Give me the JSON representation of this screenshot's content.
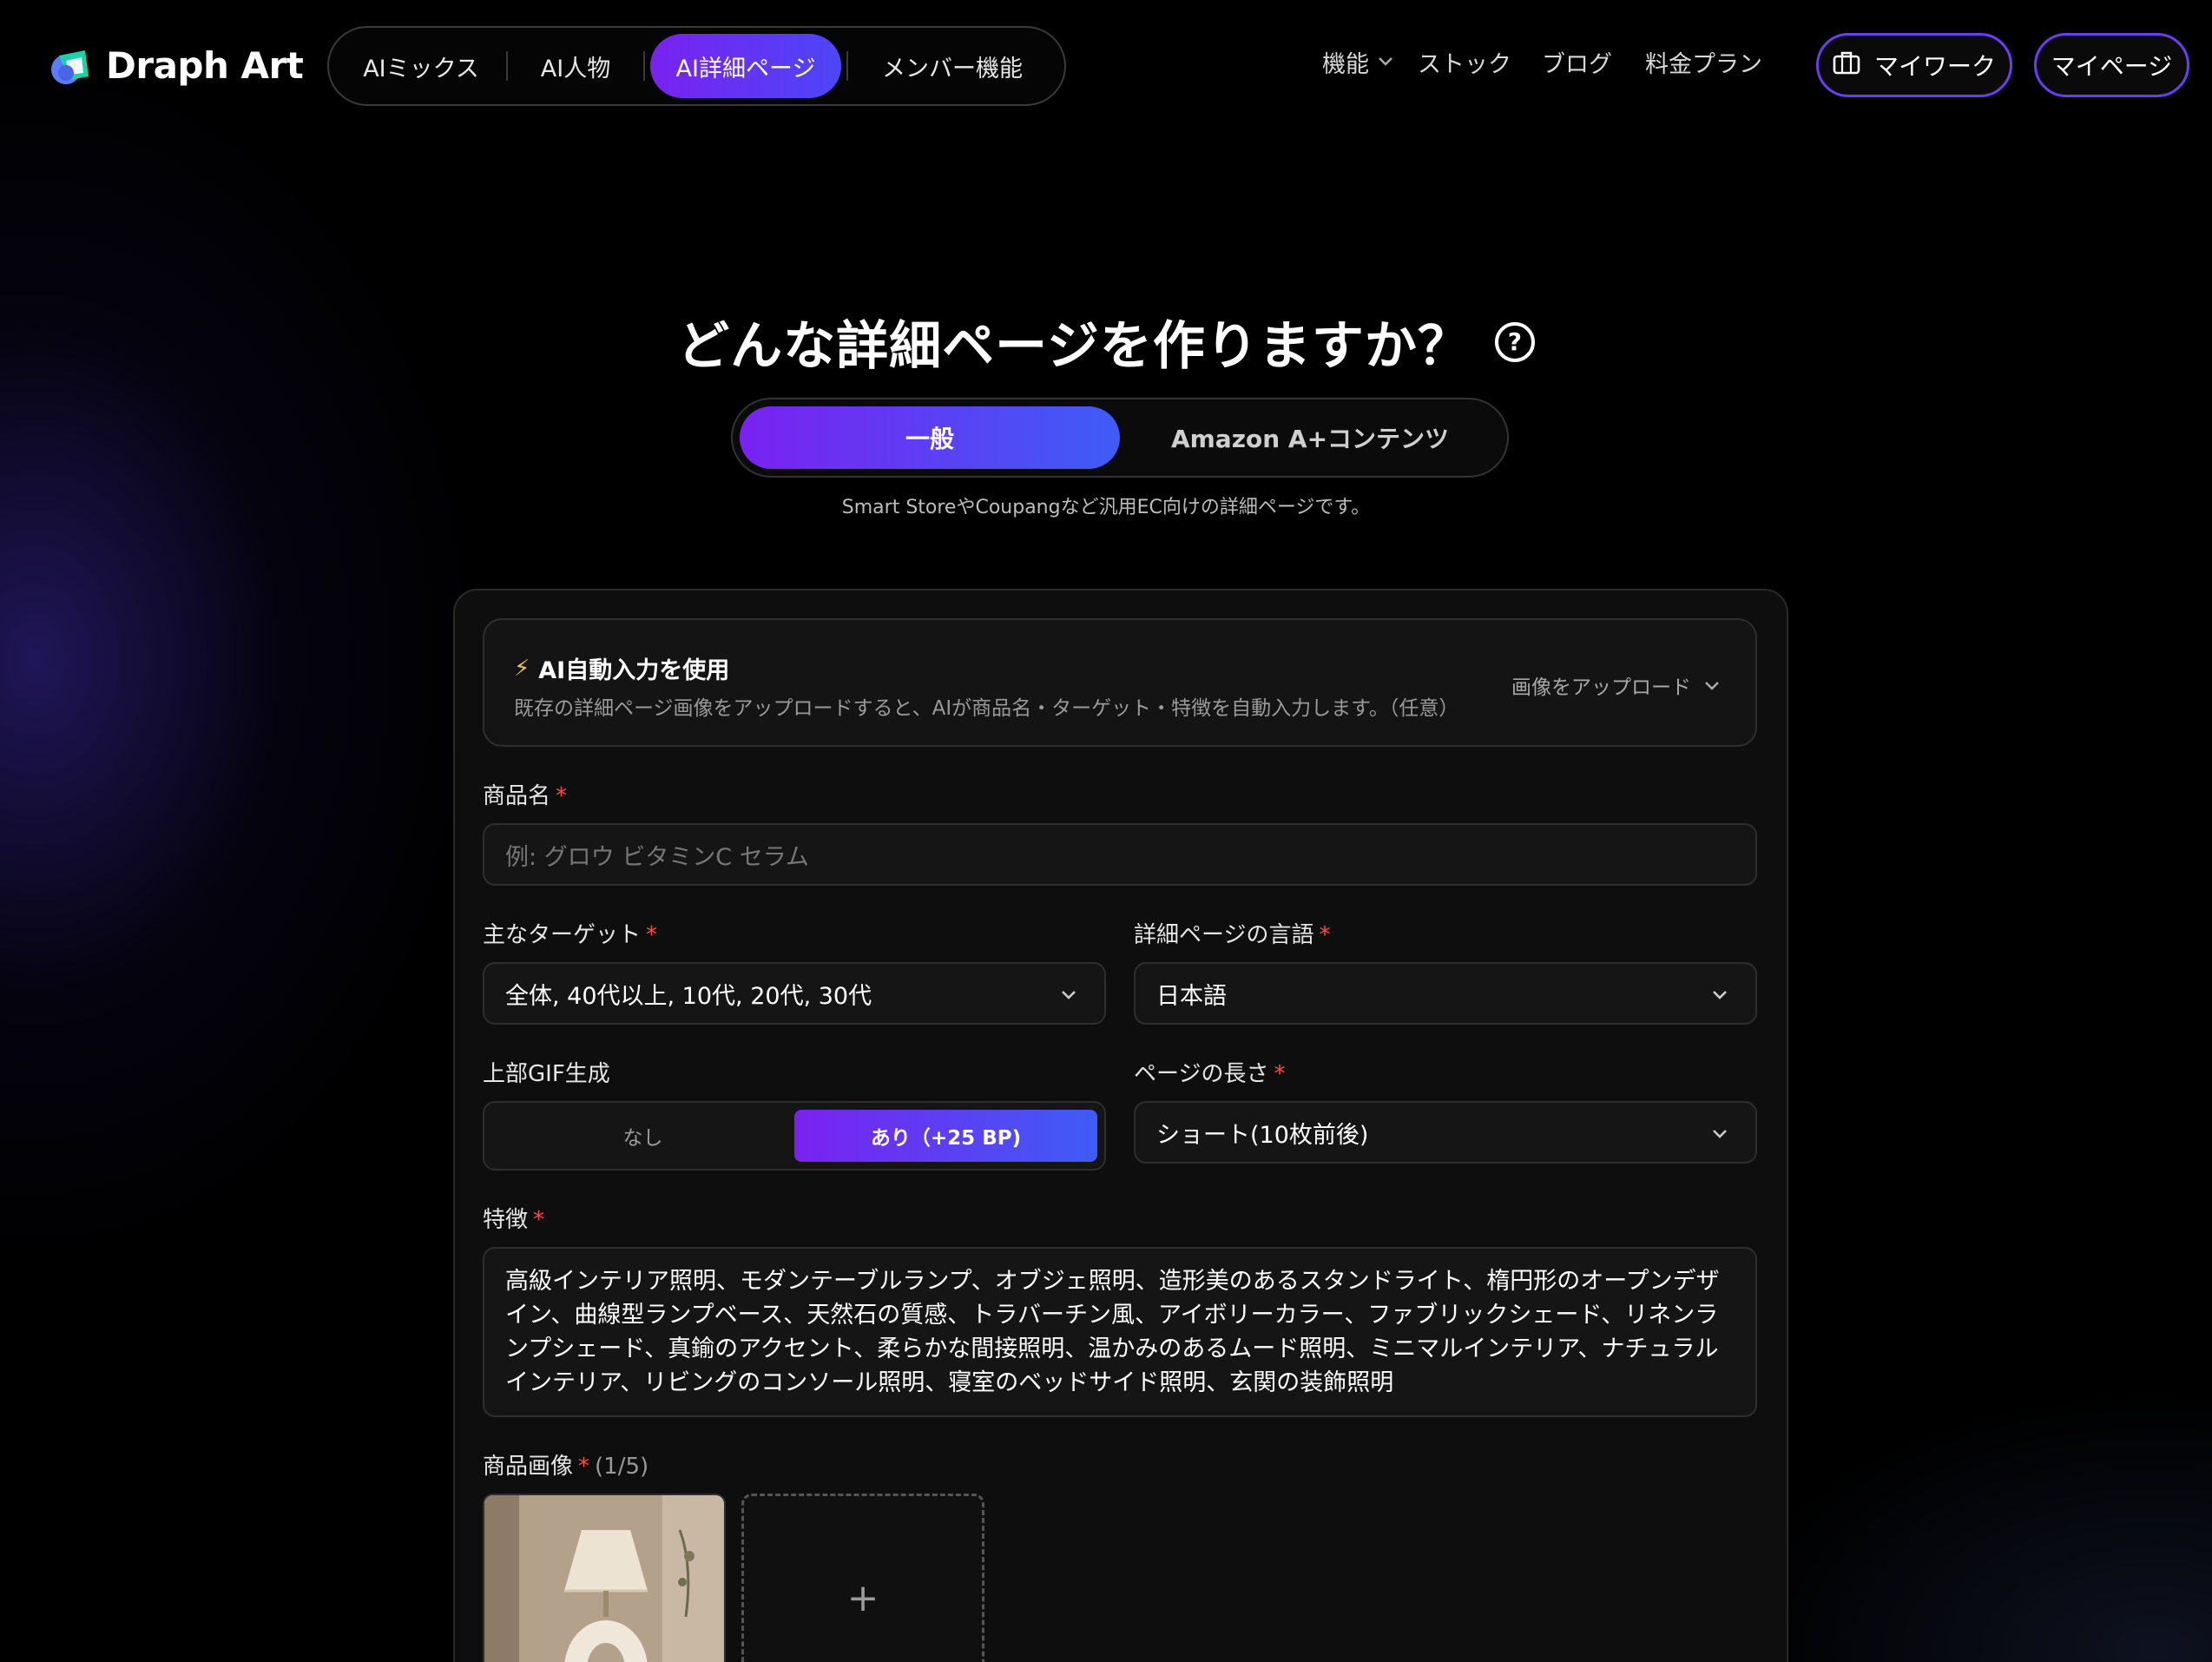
{
  "brand": {
    "name": "Draph Art"
  },
  "nav": {
    "tabs": [
      {
        "label": "AIミックス"
      },
      {
        "label": "AI人物"
      },
      {
        "label": "AI詳細ページ"
      },
      {
        "label": "メンバー機能"
      }
    ],
    "active_tab": "AI詳細ページ"
  },
  "topnav": {
    "features": "機能",
    "stock": "ストック",
    "blog": "ブログ",
    "pricing": "料金プラン",
    "mywork": "マイワーク",
    "mypage": "マイページ"
  },
  "hero": {
    "title": "どんな詳細ページを作りますか？",
    "help_icon": "question-circle-icon"
  },
  "mode": {
    "options": [
      "一般",
      "Amazon A+コンテンツ"
    ],
    "selected": "一般",
    "description": "Smart StoreやCoupangなど汎用EC向けの詳細ページです。"
  },
  "ai_autofill": {
    "title": "AI自動入力を使用",
    "description": "既存の詳細ページ画像をアップロードすると、AIが商品名・ターゲット・特徴を自動入力します。（任意）",
    "upload_label": "画像をアップロード"
  },
  "form": {
    "product_name": {
      "label": "商品名",
      "placeholder": "例: グロウ ビタミンC セラム",
      "value": ""
    },
    "target": {
      "label": "主なターゲット",
      "value": "全体, 40代以上, 10代, 20代, 30代"
    },
    "language": {
      "label": "詳細ページの言語",
      "value": "日本語"
    },
    "gif": {
      "label": "上部GIF生成",
      "options": [
        "なし",
        "あり（+25 BP)"
      ],
      "selected": "あり（+25 BP)"
    },
    "length": {
      "label": "ページの長さ",
      "value": "ショート(10枚前後)"
    },
    "features": {
      "label": "特徴",
      "value": "高級インテリア照明、モダンテーブルランプ、オブジェ照明、造形美のあるスタンドライト、楕円形のオープンデザイン、曲線型ランプベース、天然石の質感、トラバーチン風、アイボリーカラー、ファブリックシェード、リネンランプシェード、真鍮のアクセント、柔らかな間接照明、温かみのあるムード照明、ミニマルインテリア、ナチュラルインテリア、リビングのコンソール照明、寝室のベッドサイド照明、玄関の装飾照明"
    },
    "images": {
      "label": "商品画像",
      "count": "(1/5)",
      "add_icon": "plus-icon"
    }
  },
  "required_mark": "*"
}
